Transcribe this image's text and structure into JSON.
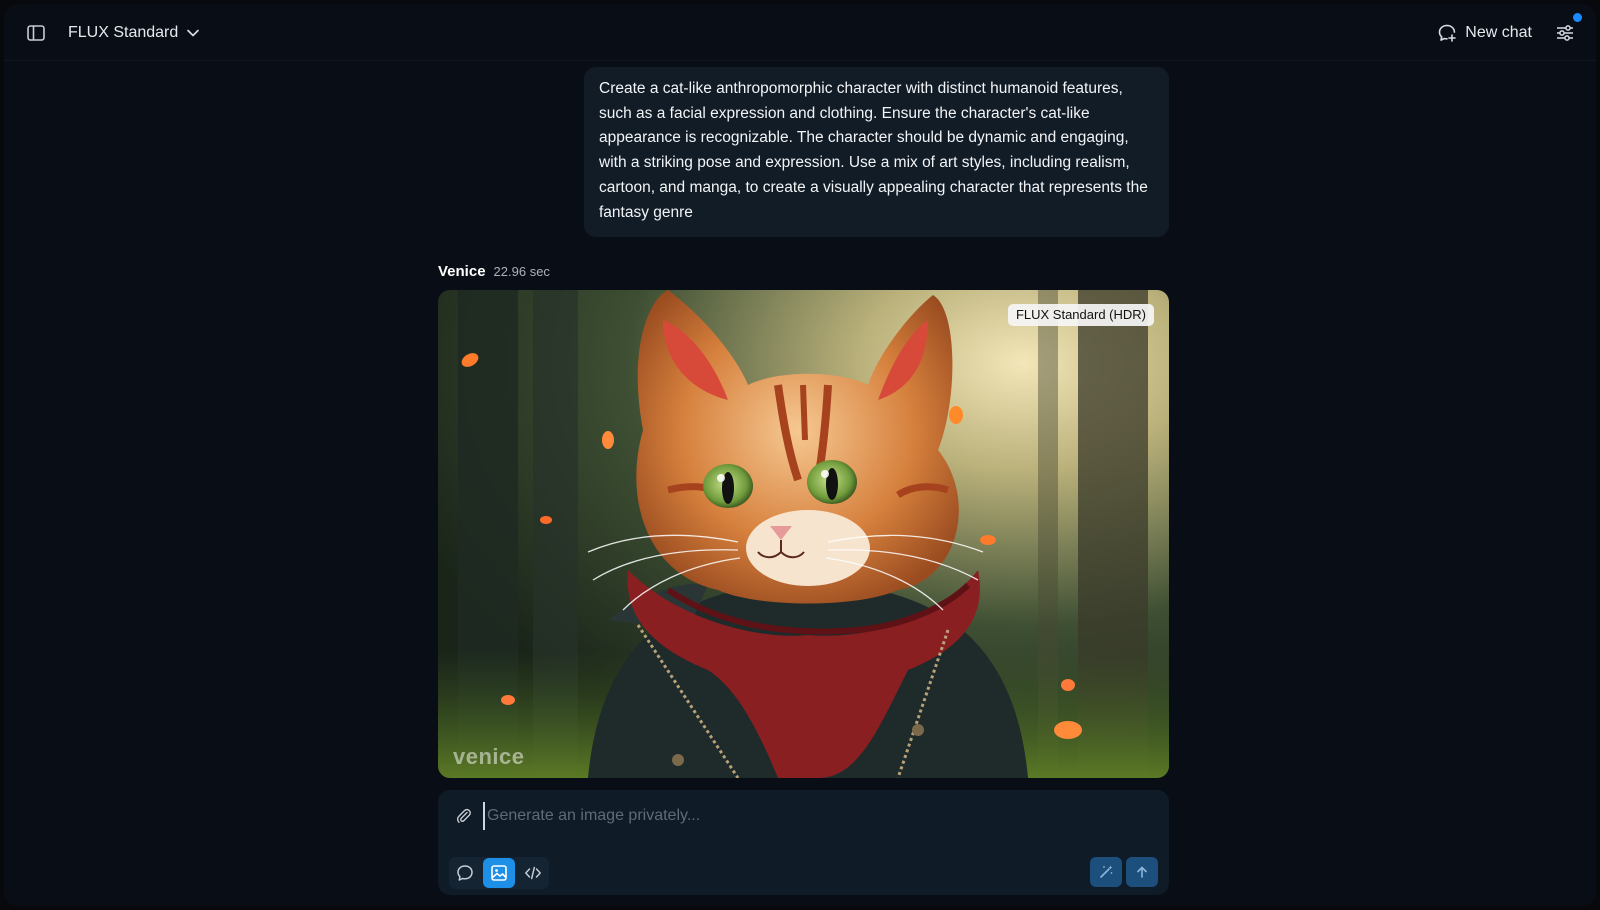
{
  "header": {
    "model_selector_label": "FLUX Standard",
    "new_chat_label": "New chat"
  },
  "user_message": {
    "text": "Create a cat-like anthropomorphic character with distinct humanoid features, such as a facial expression and clothing. Ensure the character's cat-like appearance is recognizable. The character should be dynamic and engaging, with a striking pose and expression. Use a mix of art styles, including realism, cartoon, and manga, to create a visually appealing character that represents the fantasy genre"
  },
  "response": {
    "author": "Venice",
    "elapsed": "22.96 sec",
    "image_badge": "FLUX Standard (HDR)",
    "watermark": "venice"
  },
  "composer": {
    "placeholder": "Generate an image privately...",
    "value": ""
  },
  "colors": {
    "accent": "#1d8fe6",
    "notification": "#1a8cff",
    "background": "#090e16",
    "bubble": "#111c27"
  },
  "icons": {
    "sidebar_toggle": "sidebar-icon",
    "model_dropdown": "chevron-down-icon",
    "new_chat": "new-chat-icon",
    "settings": "sliders-icon",
    "attach": "paperclip-icon",
    "mode_chat": "chat-bubble-icon",
    "mode_image": "image-icon",
    "mode_code": "code-icon",
    "enhance": "magic-wand-icon",
    "send": "arrow-up-icon"
  }
}
